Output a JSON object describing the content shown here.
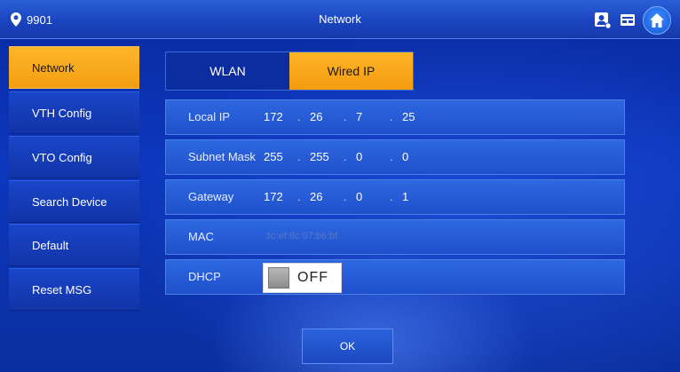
{
  "header": {
    "device_id": "9901",
    "title": "Network",
    "icons": [
      "contacts-icon",
      "message-icon",
      "home-icon"
    ]
  },
  "sidebar": {
    "items": [
      {
        "label": "Network",
        "active": true
      },
      {
        "label": "VTH Config",
        "active": false
      },
      {
        "label": "VTO Config",
        "active": false
      },
      {
        "label": "Search Device",
        "active": false
      },
      {
        "label": "Default",
        "active": false
      },
      {
        "label": "Reset MSG",
        "active": false
      }
    ]
  },
  "tabs": [
    {
      "label": "WLAN",
      "active": false
    },
    {
      "label": "Wired IP",
      "active": true
    }
  ],
  "form": {
    "local_ip": {
      "label": "Local IP",
      "octets": [
        "172",
        "26",
        "7",
        "25"
      ]
    },
    "subnet_mask": {
      "label": "Subnet Mask",
      "octets": [
        "255",
        "255",
        "0",
        "0"
      ]
    },
    "gateway": {
      "label": "Gateway",
      "octets": [
        "172",
        "26",
        "0",
        "1"
      ]
    },
    "mac": {
      "label": "MAC",
      "value": "3c:ef:8c:07:b6:bf"
    },
    "dhcp": {
      "label": "DHCP",
      "state": "OFF"
    }
  },
  "ok_label": "OK",
  "colors": {
    "accent": "#f5a21a",
    "background": "#0c37be",
    "row": "#2458d4"
  }
}
